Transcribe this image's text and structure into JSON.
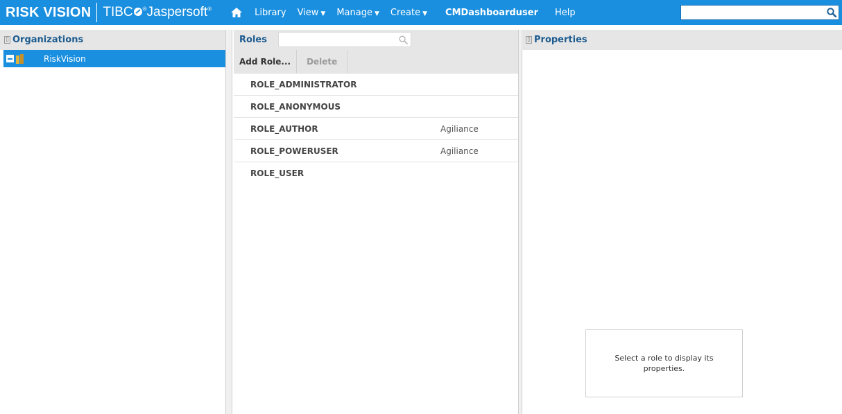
{
  "header": {
    "brand": "RISK VISION",
    "product_prefix": "TIBC",
    "product_name": "Jaspersoft",
    "nav": {
      "library": "Library",
      "view": "View",
      "manage": "Manage",
      "create": "Create",
      "user": "CMDashboarduser",
      "help": "Help"
    },
    "search": {
      "value": "",
      "placeholder": ""
    },
    "colors": {
      "bar": "#1a8fdf"
    }
  },
  "organizations": {
    "title": "Organizations",
    "tree": [
      {
        "label": "RiskVision",
        "selected": true,
        "expanded": true
      }
    ]
  },
  "roles": {
    "title": "Roles",
    "search": {
      "value": "",
      "placeholder": ""
    },
    "toolbar": {
      "add_label": "Add Role...",
      "delete_label": "Delete"
    },
    "items": [
      {
        "name": "ROLE_ADMINISTRATOR",
        "org": ""
      },
      {
        "name": "ROLE_ANONYMOUS",
        "org": ""
      },
      {
        "name": "ROLE_AUTHOR",
        "org": "Agiliance"
      },
      {
        "name": "ROLE_POWERUSER",
        "org": "Agiliance"
      },
      {
        "name": "ROLE_USER",
        "org": ""
      }
    ]
  },
  "properties": {
    "title": "Properties",
    "empty_message": "Select a role to display its properties."
  }
}
